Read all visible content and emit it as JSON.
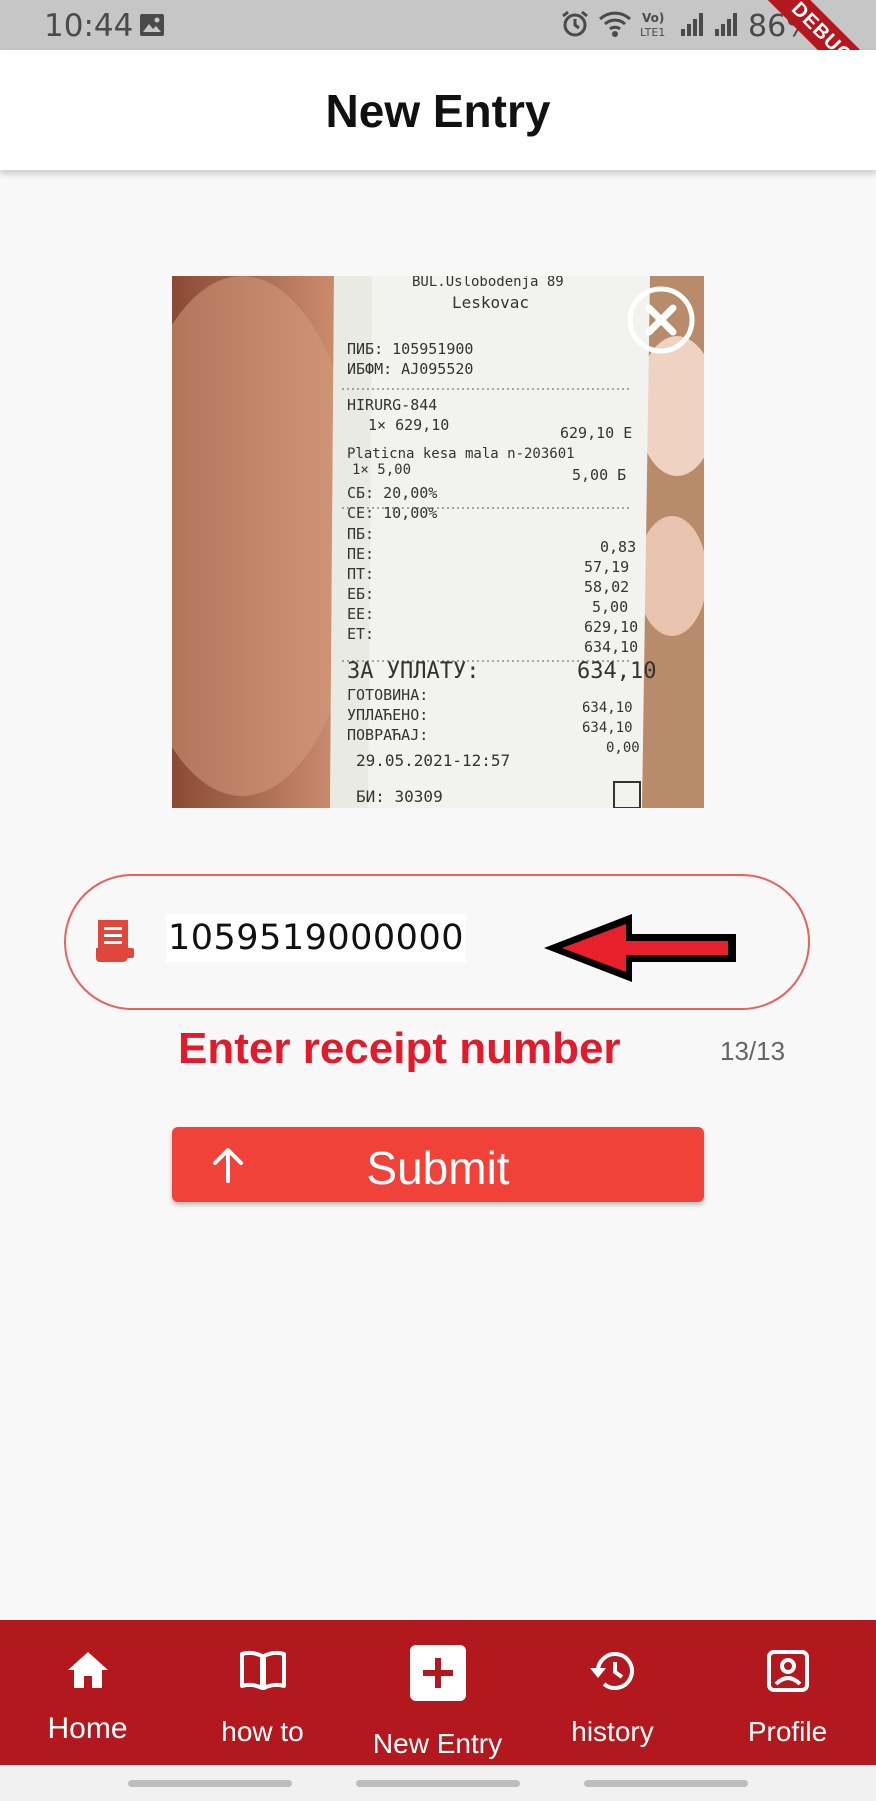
{
  "status_bar": {
    "time": "10:44",
    "battery": "86%"
  },
  "debug_banner": "DEBUG",
  "app_bar": {
    "title": "New Entry"
  },
  "receipt_photo": {
    "lines": [
      "BUL.Uslobodenja 89",
      "Leskovac",
      "ПИБ: 105951900",
      "ИБФМ: AJ095520",
      "HIRURG-844",
      "1× 629,10",
      "629,10 E",
      "Platicna kesa mala n-203601",
      "1× 5,00",
      "5,00 Б",
      "СБ: 20,00%",
      "СЕ: 10,00%",
      "ПБ:",
      "ПЕ:",
      "0,83",
      "ПТ:",
      "57,19",
      "ЕБ:",
      "58,02",
      "ЕЕ:",
      "5,00",
      "ЕТ:",
      "629,10",
      "634,10",
      "ЗА УПЛАТУ:",
      "634,10",
      "ГОТОВИНА:",
      "УПЛАЋЕНО:",
      "634,10",
      "ПОВРАЋАЈ:",
      "634,10",
      "0,00",
      "29.05.2021-12:57",
      "БИ: 30309"
    ]
  },
  "receipt_input": {
    "value": "1059519000000",
    "helper": "Enter receipt number",
    "counter": "13/13"
  },
  "submit": {
    "label": "Submit"
  },
  "bottom_nav": {
    "items": [
      {
        "label": "Home",
        "icon": "home-icon"
      },
      {
        "label": "how to",
        "icon": "book-icon"
      },
      {
        "label": "New Entry",
        "icon": "add-box-icon"
      },
      {
        "label": "history",
        "icon": "history-icon"
      },
      {
        "label": "Profile",
        "icon": "profile-icon"
      }
    ]
  },
  "colors": {
    "primary_red": "#b3181f",
    "button_red": "#f04238",
    "helper_red": "#e11b2c"
  }
}
